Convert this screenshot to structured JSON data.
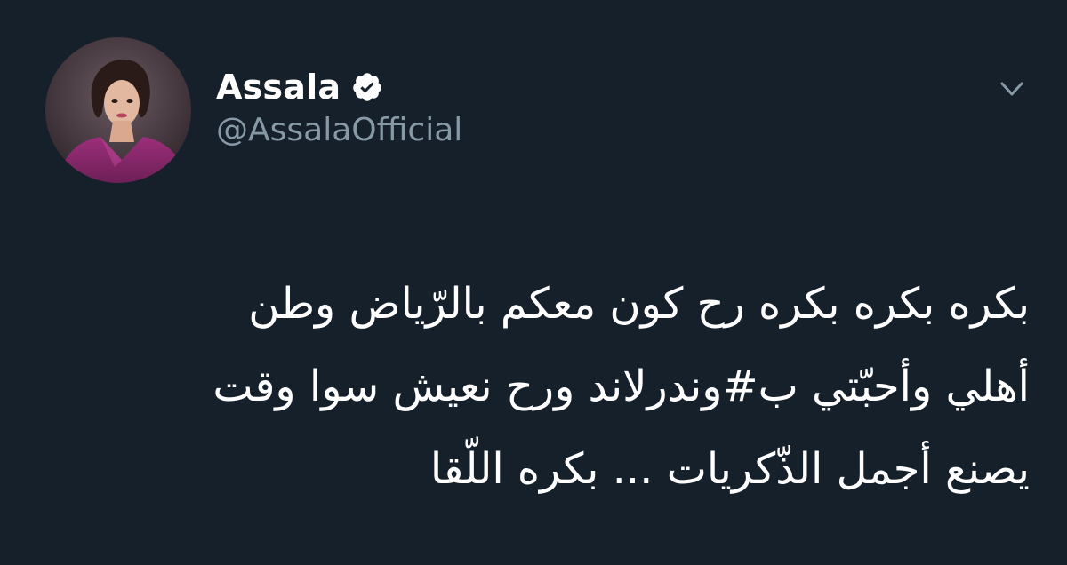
{
  "user": {
    "display_name": "Assala",
    "handle": "@AssalaOfficial",
    "verified": true,
    "avatar_icon": "profile-photo"
  },
  "menu": {
    "caret_icon": "chevron-down-icon"
  },
  "tweet": {
    "lines": [
      "بكره بكره بكره رح كون معكم بالرّياض وطن",
      "أهلي وأحبّتي ب#وندرلاند  ورح نعيش سوا وقت",
      "يصنع أجمل الذّكريات ... بكره اللّقا"
    ]
  },
  "colors": {
    "background": "#15202b",
    "text": "#ffffff",
    "secondary_text": "#8899a6"
  }
}
